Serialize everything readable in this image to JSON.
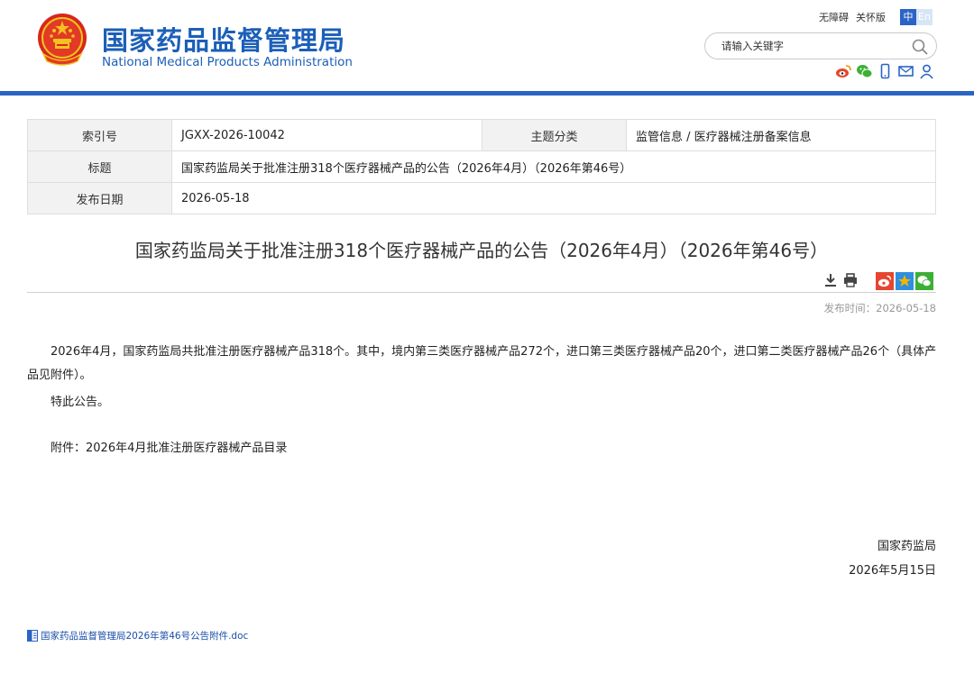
{
  "header": {
    "title_cn": "国家药品监督管理局",
    "title_en": "National Medical Products Administration",
    "accessibility_label": "无障碍",
    "care_label": "关怀版",
    "lang_zh": "中",
    "lang_en": "En",
    "search_placeholder": "请输入关键字",
    "icons": [
      "weibo-icon",
      "wechat-icon",
      "mobile-icon",
      "mail-icon",
      "user-icon"
    ]
  },
  "meta": {
    "index_label": "索引号",
    "index_value": "JGXX-2026-10042",
    "category_label": "主题分类",
    "category_value": "监管信息 / 医疗器械注册备案信息",
    "title_label": "标题",
    "title_value": "国家药监局关于批准注册318个医疗器械产品的公告（2026年4月）（2026年第46号）",
    "date_label": "发布日期",
    "date_value": "2026-05-18"
  },
  "article": {
    "title": "国家药监局关于批准注册318个医疗器械产品的公告（2026年4月）（2026年第46号）",
    "publish_time": "发布时间：2026-05-18",
    "paragraph1": "2026年4月，国家药监局共批准注册医疗器械产品318个。其中，境内第三类医疗器械产品272个，进口第三类医疗器械产品20个，进口第二类医疗器械产品26个（具体产品见附件）。",
    "paragraph2": "特此公告。",
    "attachment_line": "附件：2026年4月批准注册医疗器械产品目录",
    "signature_org": "国家药监局",
    "signature_date": "2026年5月15日",
    "attachment_file": "国家药品监督管理局2026年第46号公告附件.doc"
  },
  "colors": {
    "brand_blue": "#1b5fb8",
    "header_rule": "#2a64c5",
    "weibo_red": "#e6452f",
    "qzone_yellow": "#f5b400",
    "wechat_green": "#3cb034"
  }
}
